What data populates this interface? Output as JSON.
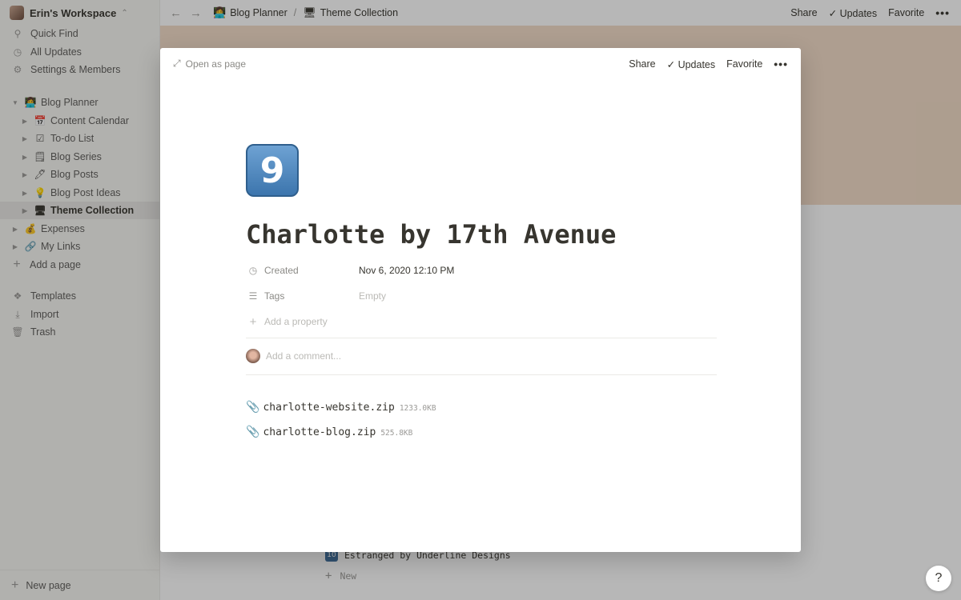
{
  "workspace": {
    "name": "Erin's Workspace"
  },
  "sidebar": {
    "top_items": [
      {
        "label": "Quick Find",
        "icon": "search-icon"
      },
      {
        "label": "All Updates",
        "icon": "clock-icon"
      },
      {
        "label": "Settings & Members",
        "icon": "gear-icon"
      }
    ],
    "tree": [
      {
        "label": "Blog Planner",
        "emoji": "👩‍💻"
      },
      {
        "label": "Content Calendar",
        "emoji": "📅"
      },
      {
        "label": "To-do List",
        "emoji": "☑"
      },
      {
        "label": "Blog Series",
        "emoji": "🗒"
      },
      {
        "label": "Blog Posts",
        "emoji": "🖊"
      },
      {
        "label": "Blog Post Ideas",
        "emoji": "💡"
      },
      {
        "label": "Theme Collection",
        "emoji": "🖥"
      },
      {
        "label": "Expenses",
        "emoji": "💰"
      },
      {
        "label": "My Links",
        "emoji": "🔗"
      },
      {
        "label": "Add a page",
        "emoji": "+"
      }
    ],
    "bottom_items": [
      {
        "label": "Templates",
        "icon": "templates-icon"
      },
      {
        "label": "Import",
        "icon": "import-icon"
      },
      {
        "label": "Trash",
        "icon": "trash-icon"
      }
    ],
    "new_page": "New page"
  },
  "topbar": {
    "breadcrumb": [
      {
        "label": "Blog Planner",
        "emoji": "👩‍💻"
      },
      {
        "label": "Theme Collection",
        "emoji": "🖥"
      }
    ],
    "share": "Share",
    "updates": "Updates",
    "favorite": "Favorite"
  },
  "background": {
    "row_label": "Estranged by Underline Designs",
    "new_label": "New",
    "help": "?"
  },
  "modal": {
    "open_as_page": "Open as page",
    "share": "Share",
    "updates": "Updates",
    "favorite": "Favorite",
    "page_icon": "9",
    "title": "Charlotte by 17th Avenue",
    "properties": [
      {
        "label": "Created",
        "value": "Nov 6, 2020 12:10 PM",
        "icon": "clock-icon"
      },
      {
        "label": "Tags",
        "value": "Empty",
        "icon": "list-icon"
      }
    ],
    "add_property": "Add a property",
    "comment_placeholder": "Add a comment...",
    "files": [
      {
        "name": "charlotte-website.zip",
        "size": "1233.0KB"
      },
      {
        "name": "charlotte-blog.zip",
        "size": "525.8KB"
      }
    ]
  },
  "colors": {
    "cover": "#f2dcc7",
    "sidebar_bg": "#f7f6f3",
    "text": "#37352f",
    "icon_blue": "#3c75ad"
  }
}
